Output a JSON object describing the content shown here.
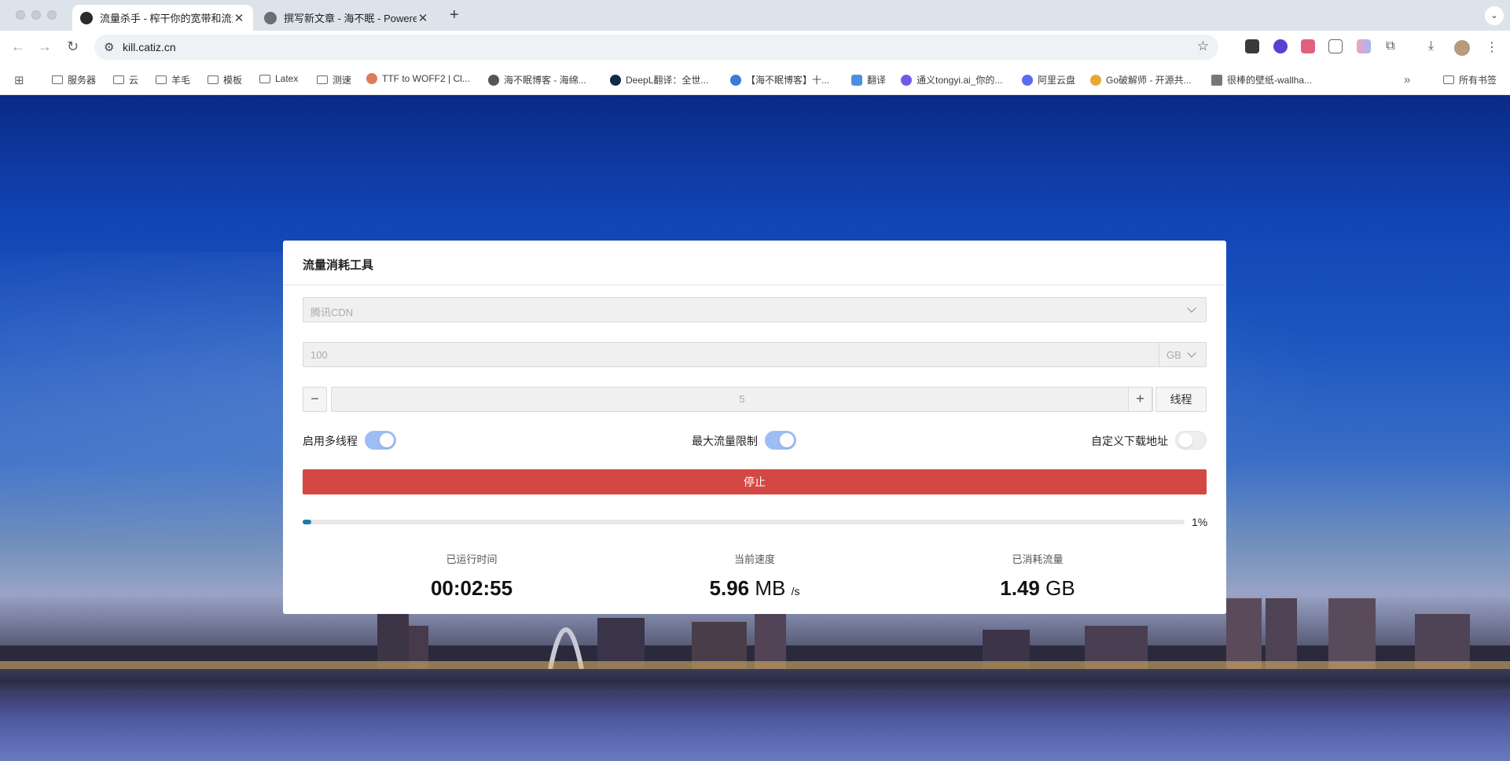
{
  "browser": {
    "tabs": [
      {
        "title": "流量杀手 - 榨干你的宽带和流量",
        "active": true
      },
      {
        "title": "撰写新文章 - 海不眠 - Powered",
        "active": false
      }
    ],
    "new_tab_symbol": "+",
    "tab_menu_symbol": "⌄",
    "url": "kill.catiz.cn",
    "bookmarks": [
      {
        "label": "服务器",
        "type": "folder"
      },
      {
        "label": "云",
        "type": "folder"
      },
      {
        "label": "羊毛",
        "type": "folder"
      },
      {
        "label": "模板",
        "type": "folder"
      },
      {
        "label": "Latex",
        "type": "folder"
      },
      {
        "label": "测速",
        "type": "folder"
      },
      {
        "label": "TTF to WOFF2 | Cl...",
        "type": "site",
        "color": "#e07a5f"
      },
      {
        "label": "海不眠博客 - 海绵...",
        "type": "site",
        "color": "#555555"
      },
      {
        "label": "DeepL翻译：全世...",
        "type": "site",
        "color": "#0f2b46"
      },
      {
        "label": "【海不眠博客】十...",
        "type": "site",
        "color": "#3a7bd5"
      },
      {
        "label": "翻译",
        "type": "site",
        "color": "#4a90e2"
      },
      {
        "label": "通义tongyi.ai_你的...",
        "type": "site",
        "color": "#6c5ce7"
      },
      {
        "label": "阿里云盘",
        "type": "site",
        "color": "#5b6cf0"
      },
      {
        "label": "Go破解师 - 开源共...",
        "type": "site",
        "color": "#e8a838"
      },
      {
        "label": "很棒的壁纸-wallha...",
        "type": "site",
        "color": "#777777"
      }
    ],
    "all_bookmarks": "所有书签",
    "more_bookmarks": "»"
  },
  "card": {
    "title": "流量消耗工具",
    "cdn_select": "腾讯CDN",
    "amount_value": "100",
    "amount_unit": "GB",
    "thread_count": "5",
    "minus_label": "−",
    "plus_label": "+",
    "thread_label": "线程",
    "options": [
      {
        "label": "启用多线程",
        "on": true
      },
      {
        "label": "最大流量限制",
        "on": true
      },
      {
        "label": "自定义下载地址",
        "on": false
      }
    ],
    "stop_label": "停止",
    "progress": 0.01,
    "progress_text": "1%",
    "stats": {
      "runtime_label": "已运行时间",
      "runtime_value": "00:02:55",
      "speed_label": "当前速度",
      "speed_value": "5.96",
      "speed_unit": "MB",
      "speed_per": "/s",
      "consumed_label": "已消耗流量",
      "consumed_value": "1.49",
      "consumed_unit": "GB"
    }
  },
  "colors": {
    "stop_button": "#d44843",
    "progress": "#1a7ea6",
    "switch_on": "#9fbdf5"
  }
}
